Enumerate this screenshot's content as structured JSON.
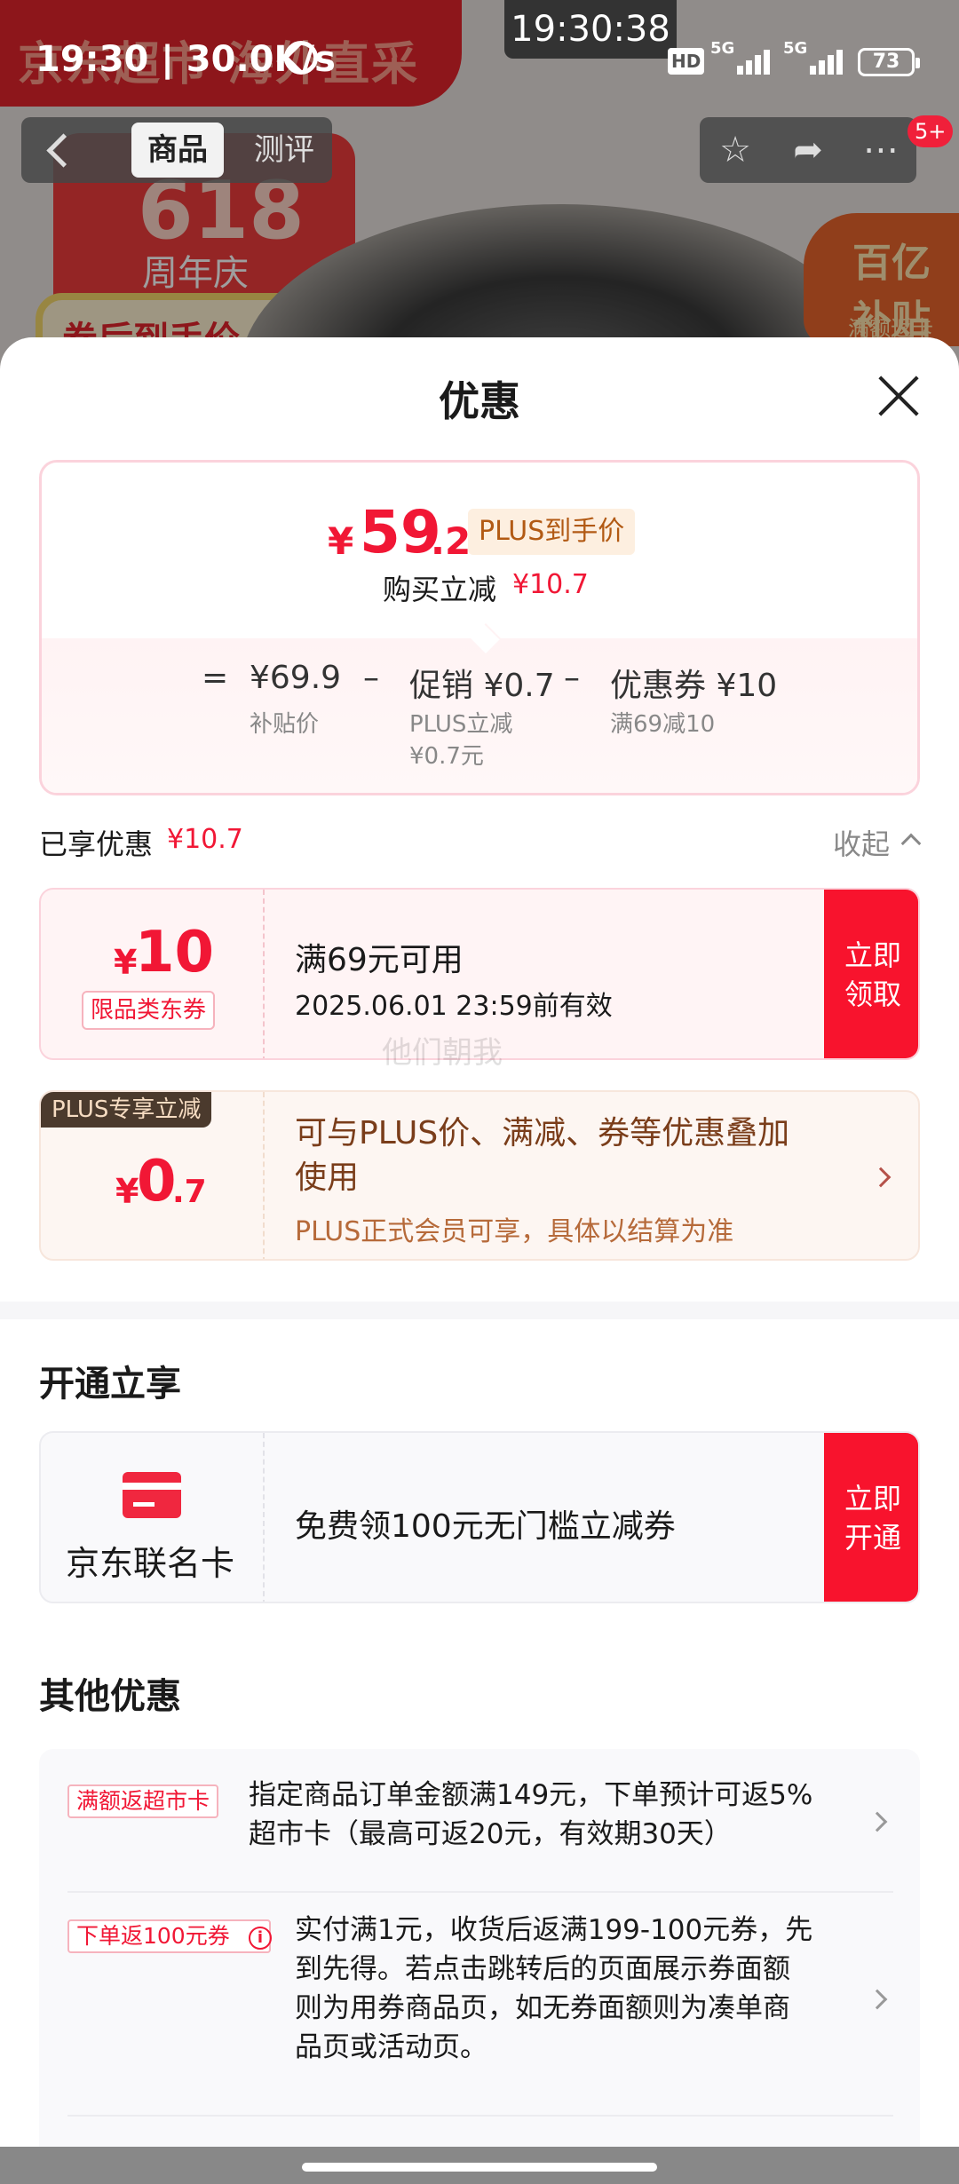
{
  "background": {
    "banner_text": "京东超市 海外直采",
    "anniversary_num": "618",
    "anniversary_sub": "周年庆",
    "coupon_text": "券后到手价",
    "subsidy_badge": "百亿补贴",
    "subsidy_sub": "满额返卡"
  },
  "status_bar": {
    "time": "19:30 | 30.0K/s",
    "center_time": "19:30:38",
    "hd": "HD",
    "net1": "5G",
    "net2": "5G",
    "battery": "73"
  },
  "top_nav": {
    "tab_goods": "商品",
    "tab_review": "测评",
    "badge": "5+",
    "icons": [
      "back-icon",
      "star-icon",
      "share-icon",
      "more-icon"
    ]
  },
  "sheet": {
    "title": "优惠"
  },
  "price_card": {
    "yen": "¥",
    "price_int": "59",
    "price_dec": ".2",
    "price_tag": "PLUS到手价",
    "reduce_label": "购买立减",
    "reduce_amount": "¥10.7",
    "equals": "=",
    "subsidy_price": "¥69.9",
    "subsidy_label": "补贴价",
    "minus1": "–",
    "promo": "促销 ¥0.7",
    "promo_note1": "PLUS立减",
    "promo_note2": "¥0.7元",
    "minus2": "–",
    "coupon": "优惠券 ¥10",
    "coupon_note": "满69减10"
  },
  "enjoyed": {
    "label": "已享优惠",
    "amount": "¥10.7",
    "collapse": "收起"
  },
  "coupon_card": {
    "yen": "¥",
    "amount": "10",
    "type": "限品类东券",
    "condition": "满69元可用",
    "validity": "2025.06.01 23:59前有效",
    "button_line1": "立即",
    "button_line2": "领取",
    "watermark": "他们朝我"
  },
  "plus_card": {
    "tag": "PLUS专享立减",
    "yen": "¥",
    "amount_int": "0",
    "amount_dec": ".7",
    "main_line1": "可与PLUS价、满减、券等优惠叠加",
    "main_line2": "使用",
    "sub": "PLUS正式会员可享，具体以结算为准"
  },
  "open_section": {
    "title": "开通立享",
    "card_name": "京东联名卡",
    "offer": "免费领100元无门槛立减券",
    "button_line1": "立即",
    "button_line2": "开通"
  },
  "other_section": {
    "title": "其他优惠",
    "items": [
      {
        "tag": "满额返超市卡",
        "line1": "指定商品订单金额满149元，下单预计可返5%",
        "line2": "超市卡（最高可返20元，有效期30天）"
      },
      {
        "tag": "下单返100元券",
        "info": "i",
        "line1": "实付满1元，收货后返满199-100元券，先",
        "line2": "到先得。若点击跳转后的页面展示券面额",
        "line3": "则为用券商品页，如无券面额则为凑单商",
        "line4": "品页或活动页。"
      }
    ]
  },
  "colors": {
    "accent_red": "#f8132d",
    "price_red": "#f11735",
    "plus_brown": "#7a3d1a"
  }
}
